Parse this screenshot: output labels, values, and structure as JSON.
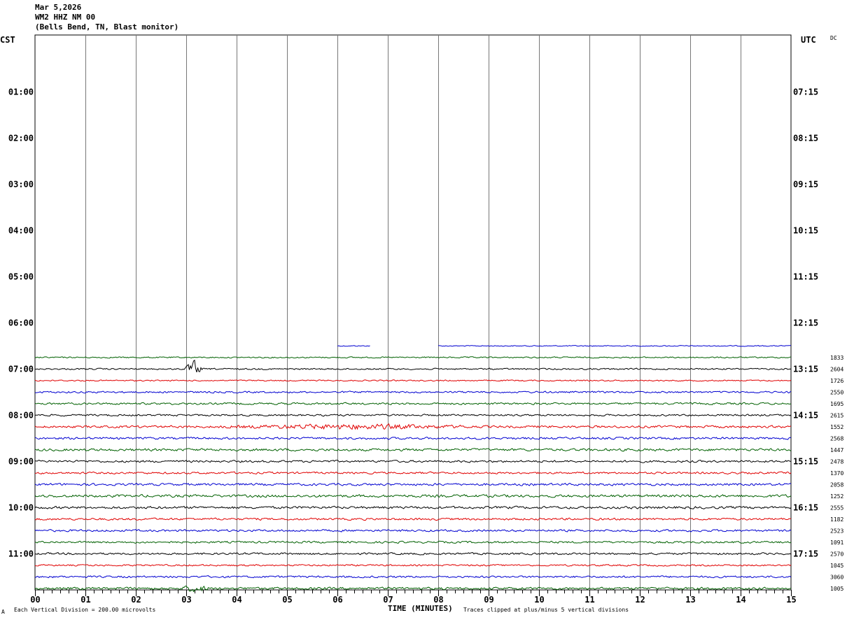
{
  "header": {
    "date": "Mar 5,2026",
    "station": "WM2 HHZ NM 00",
    "location": "(Bells Bend, TN, Blast monitor)"
  },
  "left_timezone": "CST",
  "right_timezone": "UTC",
  "corner_tag": "DC",
  "footer": {
    "scale_note": "Each Vertical Division =  200.00 microvolts",
    "clip_note": "Traces clipped at plus/minus 5 vertical divisions",
    "logo_mark": "A"
  },
  "chart_data": {
    "type": "line",
    "title": "",
    "xlabel": "TIME (MINUTES)",
    "ylabel": "",
    "x_ticks": [
      "00",
      "01",
      "02",
      "03",
      "04",
      "05",
      "06",
      "07",
      "08",
      "09",
      "10",
      "11",
      "12",
      "13",
      "14",
      "15"
    ],
    "xlim": [
      0,
      15
    ],
    "left_hour_labels": [
      "01:00",
      "02:00",
      "03:00",
      "04:00",
      "05:00",
      "06:00",
      "07:00",
      "08:00",
      "09:00",
      "10:00",
      "11:00"
    ],
    "right_hour_labels": [
      "07:15",
      "08:15",
      "09:15",
      "10:15",
      "11:15",
      "12:15",
      "13:15",
      "14:15",
      "15:15",
      "16:15",
      "17:15"
    ],
    "grid": true,
    "trace_colors": [
      "#000000",
      "#e00000",
      "#0000d0",
      "#006000"
    ],
    "traces": [
      {
        "row": 26,
        "start_min": 6.0,
        "end_min": 6.65,
        "color": "#0000d0",
        "amp": 0.6
      },
      {
        "row": 26,
        "start_min": 8.0,
        "end_min": 15.0,
        "color": "#0000d0",
        "amp": 0.6
      },
      {
        "row": 27,
        "start_min": 0,
        "end_min": 15,
        "color": "#006000",
        "amp": 0.8,
        "right_value": "1833"
      },
      {
        "row": 28,
        "start_min": 0,
        "end_min": 15,
        "color": "#000000",
        "amp": 0.9,
        "right_value": "2604",
        "event": {
          "start": 2.95,
          "end": 3.35,
          "amp": 9
        }
      },
      {
        "row": 29,
        "start_min": 0,
        "end_min": 15,
        "color": "#e00000",
        "amp": 0.8,
        "right_value": "1726"
      },
      {
        "row": 30,
        "start_min": 0,
        "end_min": 15,
        "color": "#0000d0",
        "amp": 1.1,
        "right_value": "2550"
      },
      {
        "row": 31,
        "start_min": 0,
        "end_min": 15,
        "color": "#006000",
        "amp": 1.2,
        "right_value": "1695"
      },
      {
        "row": 32,
        "start_min": 0,
        "end_min": 15,
        "color": "#000000",
        "amp": 1.1,
        "right_value": "2615"
      },
      {
        "row": 33,
        "start_min": 0,
        "end_min": 15,
        "color": "#e00000",
        "amp": 1.4,
        "right_value": "1552",
        "event": {
          "start": 3.5,
          "end": 9.0,
          "amp": 2.5
        }
      },
      {
        "row": 34,
        "start_min": 0,
        "end_min": 15,
        "color": "#0000d0",
        "amp": 1.3,
        "right_value": "2568"
      },
      {
        "row": 35,
        "start_min": 0,
        "end_min": 15,
        "color": "#006000",
        "amp": 1.5,
        "right_value": "1447"
      },
      {
        "row": 36,
        "start_min": 0,
        "end_min": 15,
        "color": "#000000",
        "amp": 1.3,
        "right_value": "2478"
      },
      {
        "row": 37,
        "start_min": 0,
        "end_min": 15,
        "color": "#e00000",
        "amp": 1.2,
        "right_value": "1370"
      },
      {
        "row": 38,
        "start_min": 0,
        "end_min": 15,
        "color": "#0000d0",
        "amp": 1.4,
        "right_value": "2058"
      },
      {
        "row": 39,
        "start_min": 0,
        "end_min": 15,
        "color": "#006000",
        "amp": 1.6,
        "right_value": "1252"
      },
      {
        "row": 40,
        "start_min": 0,
        "end_min": 15,
        "color": "#000000",
        "amp": 1.5,
        "right_value": "2555"
      },
      {
        "row": 41,
        "start_min": 0,
        "end_min": 15,
        "color": "#e00000",
        "amp": 1.3,
        "right_value": "1182"
      },
      {
        "row": 42,
        "start_min": 0,
        "end_min": 15,
        "color": "#0000d0",
        "amp": 1.3,
        "right_value": "2523"
      },
      {
        "row": 43,
        "start_min": 0,
        "end_min": 15,
        "color": "#006000",
        "amp": 1.2,
        "right_value": "1091"
      },
      {
        "row": 44,
        "start_min": 0,
        "end_min": 15,
        "color": "#000000",
        "amp": 1.2,
        "right_value": "2570"
      },
      {
        "row": 45,
        "start_min": 0,
        "end_min": 15,
        "color": "#e00000",
        "amp": 1.0,
        "right_value": "1045"
      },
      {
        "row": 46,
        "start_min": 0,
        "end_min": 15,
        "color": "#0000d0",
        "amp": 1.2,
        "right_value": "3060"
      },
      {
        "row": 47,
        "start_min": 0,
        "end_min": 15,
        "color": "#006000",
        "amp": 1.4,
        "right_value": "1005",
        "event": {
          "start": 2.85,
          "end": 3.5,
          "amp": 4
        }
      }
    ]
  }
}
